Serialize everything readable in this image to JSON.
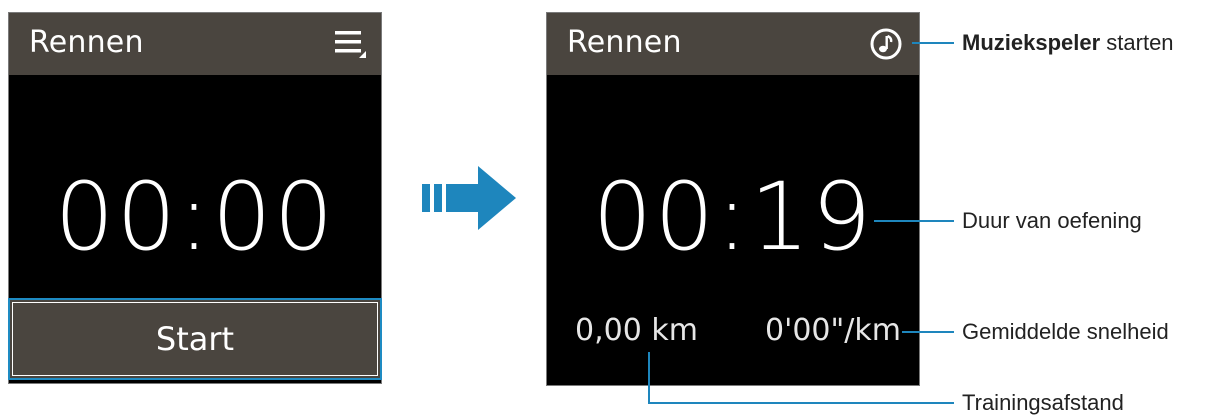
{
  "screen_left": {
    "title": "Rennen",
    "menu_icon": "menu-icon",
    "timer": "00:00",
    "start_label": "Start"
  },
  "screen_right": {
    "title": "Rennen",
    "music_icon": "music-note-icon",
    "timer": "00:19",
    "distance": "0,00 km",
    "pace": "0'00\"/km"
  },
  "callouts": {
    "music_bold": "Muziekspeler",
    "music_rest": " starten",
    "duration": "Duur van oefening",
    "speed": "Gemiddelde snelheid",
    "distance": "Trainingsafstand"
  },
  "colors": {
    "titlebar": "#4a453f",
    "accent": "#1e86bd",
    "screen_bg": "#000000"
  }
}
